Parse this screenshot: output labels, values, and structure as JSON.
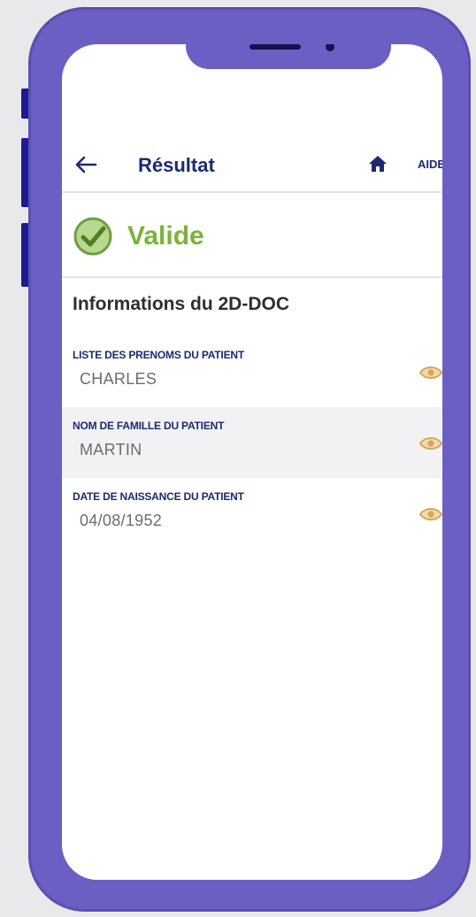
{
  "header": {
    "title": "Résultat",
    "help_label": "AIDE"
  },
  "status": {
    "label": "Valide",
    "color": "#79b43a"
  },
  "section": {
    "title": "Informations du 2D-DOC"
  },
  "fields": [
    {
      "label": "LISTE DES PRENOMS DU PATIENT",
      "value": "CHARLES"
    },
    {
      "label": "NOM DE FAMILLE DU PATIENT",
      "value": "MARTIN"
    },
    {
      "label": "DATE DE NAISSANCE DU PATIENT",
      "value": "04/08/1952"
    }
  ],
  "icons": {
    "back": "arrow-left-icon",
    "home": "home-icon",
    "status": "check-circle-icon",
    "reveal": "eye-icon"
  },
  "colors": {
    "frame": "#6b5fc4",
    "primary_text": "#1b2a72",
    "eye": "#d4a85a"
  }
}
